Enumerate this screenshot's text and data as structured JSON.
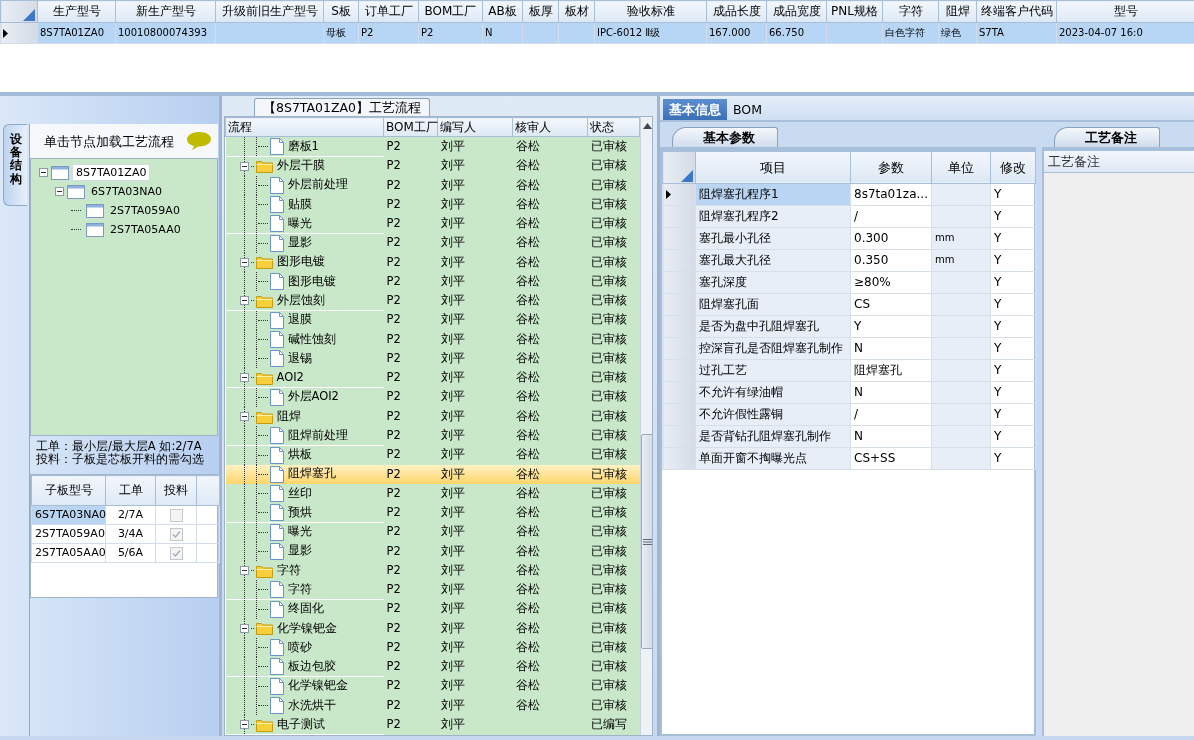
{
  "top_grid": {
    "columns": [
      "生产型号",
      "新生产型号",
      "升级前旧生产型号",
      "S板",
      "订单工厂",
      "BOM工厂",
      "AB板",
      "板厚",
      "板材",
      "验收标准",
      "成品长度",
      "成品宽度",
      "PNL规格",
      "字符",
      "阻焊",
      "终端客户代码",
      "型号"
    ],
    "rows": [
      {
        "selected": true,
        "cells": [
          "8S7TA01ZA0",
          "10010800074393",
          null,
          "母板",
          "P2",
          "P2",
          "N",
          null,
          null,
          "IPC-6012 Ⅱ级",
          "167.000",
          "66.750",
          null,
          "白色字符",
          "绿色",
          "S7TA",
          "2023-04-07 16:0"
        ]
      }
    ]
  },
  "structure_panel": {
    "side_tab": "设备结构",
    "hint": "单击节点加载工艺流程",
    "tree": [
      {
        "label": "8S7TA01ZA0",
        "selected": true,
        "expanded": true,
        "children": [
          {
            "label": "6S7TA03NA0",
            "selected": false,
            "expanded": true,
            "children": [
              {
                "label": "2S7TA059A0",
                "selected": false
              },
              {
                "label": "2S7TA05AA0",
                "selected": false
              }
            ]
          }
        ]
      }
    ],
    "notes": [
      "工单：最小层/最大层A 如:2/7A",
      "投料：子板是芯板开料的需勾选"
    ],
    "sub_grid": {
      "columns": [
        "子板型号",
        "工单",
        "投料"
      ],
      "rows": [
        {
          "model": "6S7TA03NA0",
          "order": "2/7A",
          "checked": false,
          "selected": true
        },
        {
          "model": "2S7TA059A0",
          "order": "3/4A",
          "checked": true,
          "selected": false
        },
        {
          "model": "2S7TA05AA0",
          "order": "5/6A",
          "checked": true,
          "selected": false
        }
      ]
    }
  },
  "flow_panel": {
    "title": "【8S7TA01ZA0】工艺流程",
    "columns": [
      "流程",
      "BOM工厂",
      "编写人",
      "核审人",
      "状态"
    ],
    "rows": [
      {
        "kind": "step",
        "name": "磨板1",
        "factory": "P2",
        "author": "刘平",
        "reviewer": "谷松",
        "status": "已审核",
        "selected": false
      },
      {
        "kind": "group",
        "name": "外层干膜",
        "factory": "P2",
        "author": "刘平",
        "reviewer": "谷松",
        "status": "已审核",
        "selected": false,
        "expanded": true,
        "children": [
          {
            "kind": "step",
            "name": "外层前处理",
            "factory": "P2",
            "author": "刘平",
            "reviewer": "谷松",
            "status": "已审核",
            "selected": false
          },
          {
            "kind": "step",
            "name": "贴膜",
            "factory": "P2",
            "author": "刘平",
            "reviewer": "谷松",
            "status": "已审核",
            "selected": false
          },
          {
            "kind": "step",
            "name": "曝光",
            "factory": "P2",
            "author": "刘平",
            "reviewer": "谷松",
            "status": "已审核",
            "selected": false
          },
          {
            "kind": "step",
            "name": "显影",
            "factory": "P2",
            "author": "刘平",
            "reviewer": "谷松",
            "status": "已审核",
            "selected": false
          }
        ]
      },
      {
        "kind": "group",
        "name": "图形电镀",
        "factory": "P2",
        "author": "刘平",
        "reviewer": "谷松",
        "status": "已审核",
        "selected": false,
        "expanded": true,
        "children": [
          {
            "kind": "step",
            "name": "图形电镀",
            "factory": "P2",
            "author": "刘平",
            "reviewer": "谷松",
            "status": "已审核",
            "selected": false
          }
        ]
      },
      {
        "kind": "group",
        "name": "外层蚀刻",
        "factory": "P2",
        "author": "刘平",
        "reviewer": "谷松",
        "status": "已审核",
        "selected": false,
        "expanded": true,
        "children": [
          {
            "kind": "step",
            "name": "退膜",
            "factory": "P2",
            "author": "刘平",
            "reviewer": "谷松",
            "status": "已审核",
            "selected": false
          },
          {
            "kind": "step",
            "name": "碱性蚀刻",
            "factory": "P2",
            "author": "刘平",
            "reviewer": "谷松",
            "status": "已审核",
            "selected": false
          },
          {
            "kind": "step",
            "name": "退锡",
            "factory": "P2",
            "author": "刘平",
            "reviewer": "谷松",
            "status": "已审核",
            "selected": false
          }
        ]
      },
      {
        "kind": "group",
        "name": "AOI2",
        "factory": "P2",
        "author": "刘平",
        "reviewer": "谷松",
        "status": "已审核",
        "selected": false,
        "expanded": true,
        "children": [
          {
            "kind": "step",
            "name": "外层AOI2",
            "factory": "P2",
            "author": "刘平",
            "reviewer": "谷松",
            "status": "已审核",
            "selected": false
          }
        ]
      },
      {
        "kind": "group",
        "name": "阻焊",
        "factory": "P2",
        "author": "刘平",
        "reviewer": "谷松",
        "status": "已审核",
        "selected": false,
        "expanded": true,
        "children": [
          {
            "kind": "step",
            "name": "阻焊前处理",
            "factory": "P2",
            "author": "刘平",
            "reviewer": "谷松",
            "status": "已审核",
            "selected": false
          },
          {
            "kind": "step",
            "name": "烘板",
            "factory": "P2",
            "author": "刘平",
            "reviewer": "谷松",
            "status": "已审核",
            "selected": false
          },
          {
            "kind": "step",
            "name": "阻焊塞孔",
            "factory": "P2",
            "author": "刘平",
            "reviewer": "谷松",
            "status": "已审核",
            "selected": true
          },
          {
            "kind": "step",
            "name": "丝印",
            "factory": "P2",
            "author": "刘平",
            "reviewer": "谷松",
            "status": "已审核",
            "selected": false
          },
          {
            "kind": "step",
            "name": "预烘",
            "factory": "P2",
            "author": "刘平",
            "reviewer": "谷松",
            "status": "已审核",
            "selected": false
          },
          {
            "kind": "step",
            "name": "曝光",
            "factory": "P2",
            "author": "刘平",
            "reviewer": "谷松",
            "status": "已审核",
            "selected": false
          },
          {
            "kind": "step",
            "name": "显影",
            "factory": "P2",
            "author": "刘平",
            "reviewer": "谷松",
            "status": "已审核",
            "selected": false
          }
        ]
      },
      {
        "kind": "group",
        "name": "字符",
        "factory": "P2",
        "author": "刘平",
        "reviewer": "谷松",
        "status": "已审核",
        "selected": false,
        "expanded": true,
        "children": [
          {
            "kind": "step",
            "name": "字符",
            "factory": "P2",
            "author": "刘平",
            "reviewer": "谷松",
            "status": "已审核",
            "selected": false
          },
          {
            "kind": "step",
            "name": "终固化",
            "factory": "P2",
            "author": "刘平",
            "reviewer": "谷松",
            "status": "已审核",
            "selected": false
          }
        ]
      },
      {
        "kind": "group",
        "name": "化学镍钯金",
        "factory": "P2",
        "author": "刘平",
        "reviewer": "谷松",
        "status": "已审核",
        "selected": false,
        "expanded": true,
        "children": [
          {
            "kind": "step",
            "name": "喷砂",
            "factory": "P2",
            "author": "刘平",
            "reviewer": "谷松",
            "status": "已审核",
            "selected": false
          },
          {
            "kind": "step",
            "name": "板边包胶",
            "factory": "P2",
            "author": "刘平",
            "reviewer": "谷松",
            "status": "已审核",
            "selected": false
          },
          {
            "kind": "step",
            "name": "化学镍钯金",
            "factory": "P2",
            "author": "刘平",
            "reviewer": "谷松",
            "status": "已审核",
            "selected": false
          },
          {
            "kind": "step",
            "name": "水洗烘干",
            "factory": "P2",
            "author": "刘平",
            "reviewer": "谷松",
            "status": "已审核",
            "selected": false
          }
        ]
      },
      {
        "kind": "group",
        "name": "电子测试",
        "factory": "P2",
        "author": "刘平",
        "status": "已编写",
        "selected": false,
        "expanded": true
      }
    ]
  },
  "detail_panel": {
    "tabs": [
      {
        "label": "基本信息",
        "selected": true
      },
      {
        "label": "BOM",
        "selected": false
      }
    ],
    "params": {
      "tab": "基本参数",
      "columns": [
        "项目",
        "参数",
        "单位",
        "修改"
      ],
      "rows": [
        {
          "item": "阻焊塞孔程序1",
          "value": "8s7ta01za...",
          "modify": "Y",
          "selected": true
        },
        {
          "item": "阻焊塞孔程序2",
          "value": "/",
          "modify": "Y",
          "selected": false
        },
        {
          "item": "塞孔最小孔径",
          "value": "0.300",
          "unit": "mm",
          "modify": "Y",
          "selected": false
        },
        {
          "item": "塞孔最大孔径",
          "value": "0.350",
          "unit": "mm",
          "modify": "Y",
          "selected": false
        },
        {
          "item": "塞孔深度",
          "value": "≥80%",
          "modify": "Y",
          "selected": false
        },
        {
          "item": "阻焊塞孔面",
          "value": "CS",
          "modify": "Y",
          "selected": false
        },
        {
          "item": "是否为盘中孔阻焊塞孔",
          "value": "Y",
          "modify": "Y",
          "selected": false
        },
        {
          "item": "控深盲孔是否阻焊塞孔制作",
          "value": "N",
          "modify": "Y",
          "selected": false
        },
        {
          "item": "过孔工艺",
          "value": "阻焊塞孔",
          "modify": "Y",
          "selected": false
        },
        {
          "item": "不允许有绿油帽",
          "value": "N",
          "modify": "Y",
          "selected": false
        },
        {
          "item": "不允许假性露铜",
          "value": "/",
          "modify": "Y",
          "selected": false
        },
        {
          "item": "是否背钻孔阻焊塞孔制作",
          "value": "N",
          "modify": "Y",
          "selected": false
        },
        {
          "item": "单面开窗不掏曝光点",
          "value": "CS+SS",
          "modify": "Y",
          "selected": false
        }
      ]
    },
    "notes": {
      "tab": "工艺备注",
      "column": "工艺备注"
    }
  }
}
